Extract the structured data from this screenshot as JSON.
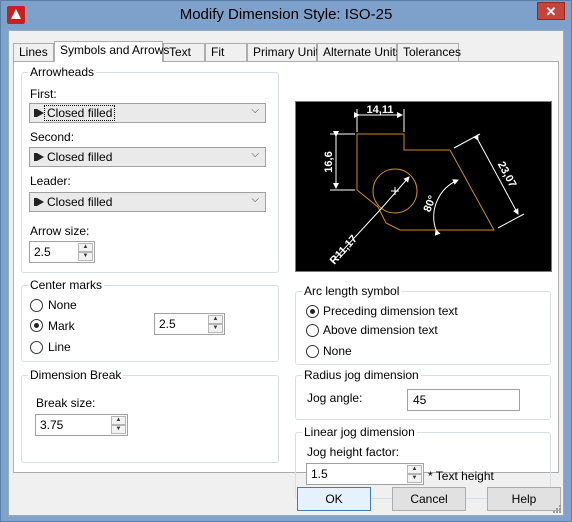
{
  "window": {
    "title": "Modify Dimension Style: ISO-25",
    "close_label": "✕"
  },
  "tabs": [
    "Lines",
    "Symbols and Arrows",
    "Text",
    "Fit",
    "Primary Units",
    "Alternate Units",
    "Tolerances"
  ],
  "active_tab": "Symbols and Arrows",
  "arrowheads": {
    "title": "Arrowheads",
    "first_label": "First:",
    "first_value": "Closed filled",
    "second_label": "Second:",
    "second_value": "Closed filled",
    "leader_label": "Leader:",
    "leader_value": "Closed filled",
    "arrow_size_label": "Arrow size:",
    "arrow_size_value": "2.5"
  },
  "center_marks": {
    "title": "Center marks",
    "options": [
      "None",
      "Mark",
      "Line"
    ],
    "selected": "Mark",
    "size_value": "2.5"
  },
  "dimension_break": {
    "title": "Dimension Break",
    "break_size_label": "Break size:",
    "break_size_value": "3.75"
  },
  "preview": {
    "dim_top": "14,11",
    "dim_left": "16,6",
    "dim_diag": "23,07",
    "angle": "80°",
    "radius": "R11,17"
  },
  "arc_length_symbol": {
    "title": "Arc length symbol",
    "options": [
      "Preceding dimension text",
      "Above dimension text",
      "None"
    ],
    "selected": "Preceding dimension text"
  },
  "radius_jog": {
    "title": "Radius jog dimension",
    "jog_angle_label": "Jog angle:",
    "jog_angle_value": "45"
  },
  "linear_jog": {
    "title": "Linear jog dimension",
    "height_factor_label": "Jog height factor:",
    "height_factor_value": "1.5",
    "suffix": "* Text height"
  },
  "buttons": {
    "ok": "OK",
    "cancel": "Cancel",
    "help": "Help"
  },
  "colors": {
    "titlebar": "#7ea1cb",
    "close": "#c7443b",
    "preview_bg": "#000000",
    "preview_geometry": "#d08a26",
    "preview_dims": "#ffffff"
  }
}
